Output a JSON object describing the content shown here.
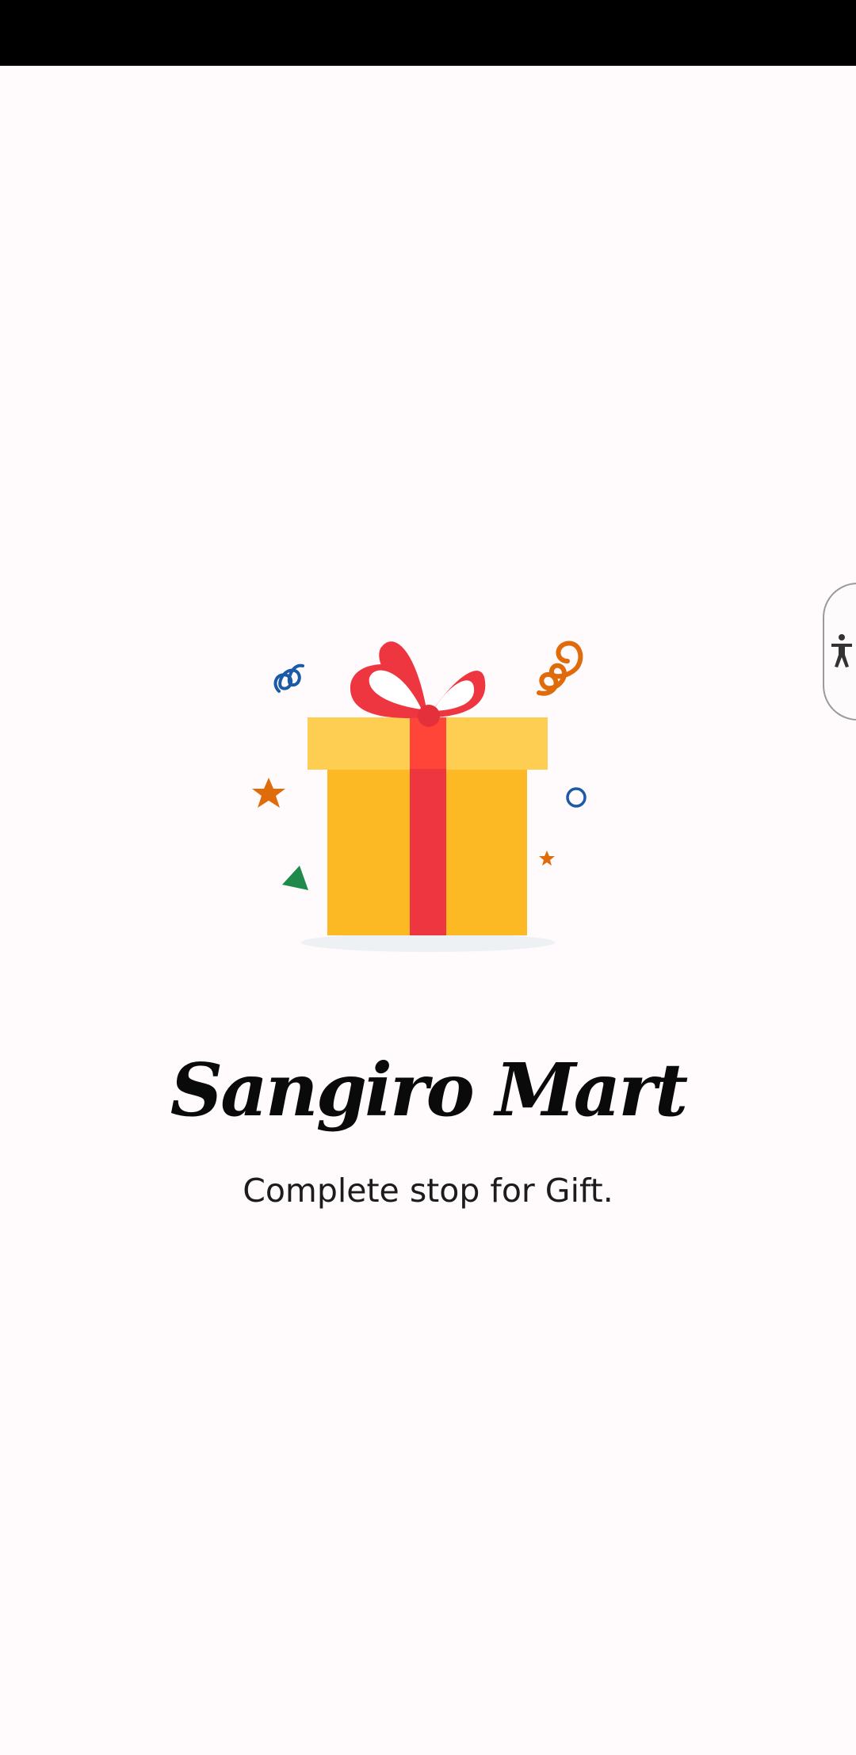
{
  "app": {
    "name": "Sangiro Mart",
    "tagline": "Complete stop for Gift."
  },
  "illustration": {
    "icon": "gift-box-icon",
    "colors": {
      "box": "#fdb924",
      "lid": "#fece52",
      "ribbon": "#ee3641",
      "ribbon_light": "#ff4538",
      "shadow": "#eef1f3",
      "confetti_blue": "#1c5aa8",
      "confetti_orange": "#e06b0b",
      "confetti_green": "#1f8a4c"
    }
  },
  "accessibility": {
    "icon": "accessibility-person-icon"
  },
  "colors": {
    "background": "#fffbfd",
    "status_bar": "#000000",
    "text": "#0a0a0a"
  }
}
